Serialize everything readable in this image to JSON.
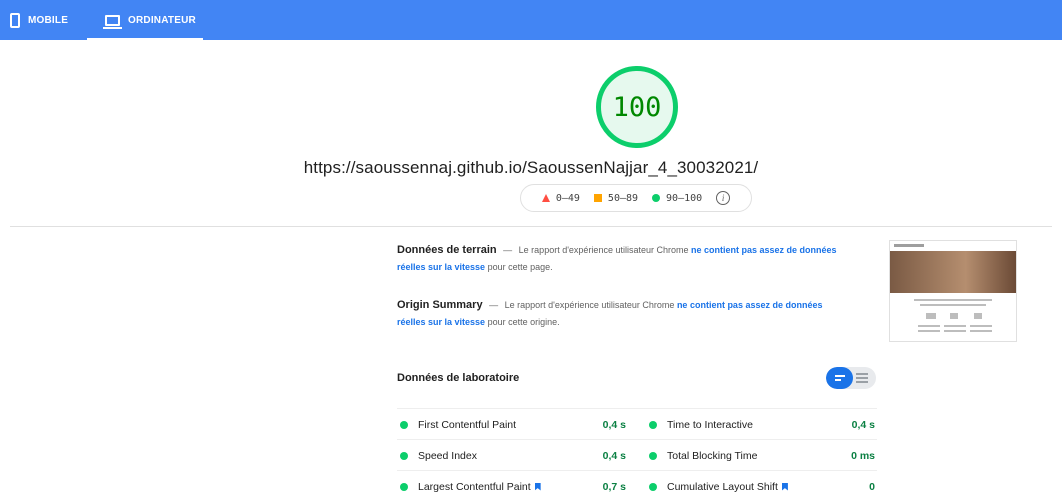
{
  "tabs": [
    {
      "label": "MOBILE",
      "icon": "phone-icon"
    },
    {
      "label": "ORDINATEUR",
      "icon": "desktop-icon",
      "active": true
    }
  ],
  "score": {
    "value": "100",
    "color": "#0cce6b"
  },
  "url": "https://saoussennaj.github.io/SaoussenNajjar_4_30032021/",
  "legend": [
    {
      "label": "0–49",
      "shape": "triangle",
      "color": "#ff4e42"
    },
    {
      "label": "50–89",
      "shape": "square",
      "color": "#ffa400"
    },
    {
      "label": "90–100",
      "shape": "circle",
      "color": "#0cce6b"
    }
  ],
  "field_data": {
    "title": "Données de terrain",
    "separator": "—",
    "text_before": "Le rapport d'expérience utilisateur Chrome",
    "link": "ne contient pas assez de données réelles sur la vitesse",
    "text_after": "pour cette page."
  },
  "origin_summary": {
    "title": "Origin Summary",
    "separator": "—",
    "text_before": "Le rapport d'expérience utilisateur Chrome",
    "link": "ne contient pas assez de données réelles sur la vitesse",
    "text_after": "pour cette origine."
  },
  "lab": {
    "title": "Données de laboratoire",
    "metrics": [
      {
        "label": "First Contentful Paint",
        "value": "0,4 s"
      },
      {
        "label": "Time to Interactive",
        "value": "0,4 s"
      },
      {
        "label": "Speed Index",
        "value": "0,4 s"
      },
      {
        "label": "Total Blocking Time",
        "value": "0 ms"
      },
      {
        "label": "Largest Contentful Paint",
        "value": "0,7 s",
        "flag": true
      },
      {
        "label": "Cumulative Layout Shift",
        "value": "0",
        "flag": true
      }
    ]
  },
  "colors": {
    "accent": "#4285f4",
    "good": "#0cce6b",
    "link": "#1a73e8"
  }
}
